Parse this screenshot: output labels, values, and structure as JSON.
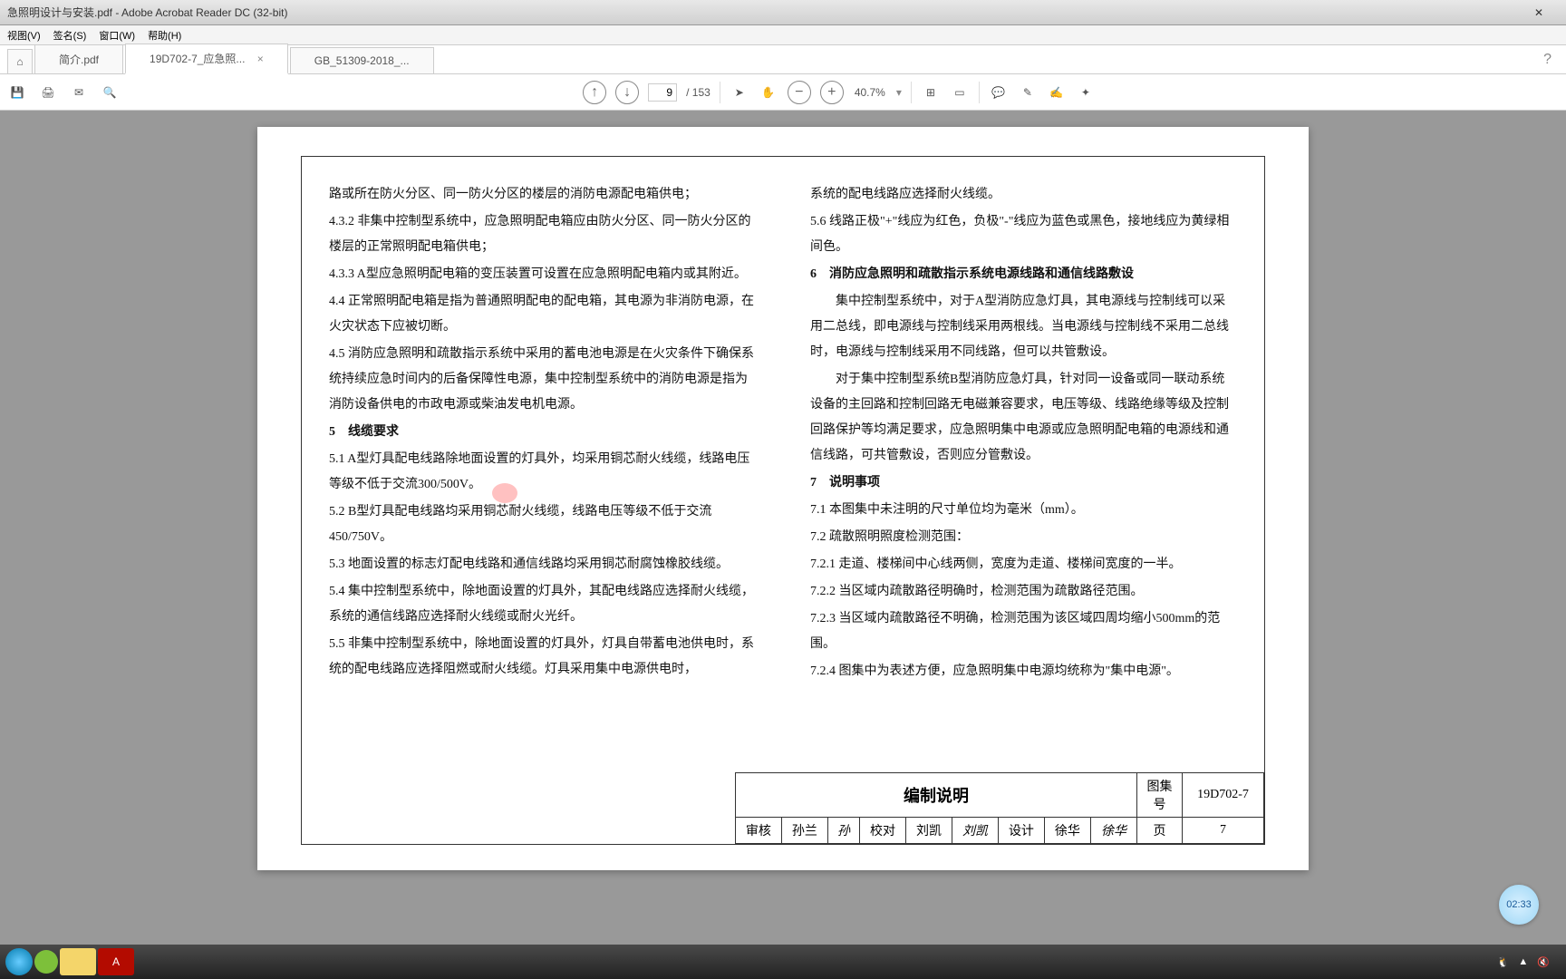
{
  "title": "急照明设计与安装.pdf - Adobe Acrobat Reader DC (32-bit)",
  "menu": {
    "view": "视图(V)",
    "sign": "签名(S)",
    "window": "窗口(W)",
    "help": "帮助(H)"
  },
  "tabs": {
    "t1": "简介.pdf",
    "t2": "19D702-7_应急照...",
    "t3": "GB_51309-2018_..."
  },
  "page": {
    "current": "9",
    "total": "/ 153",
    "zoom": "40.7%"
  },
  "doc": {
    "left": {
      "p1": "路或所在防火分区、同一防火分区的楼层的消防电源配电箱供电；",
      "p2": "4.3.2 非集中控制型系统中，应急照明配电箱应由防火分区、同一防火分区的楼层的正常照明配电箱供电；",
      "p3": "4.3.3  A型应急照明配电箱的变压装置可设置在应急照明配电箱内或其附近。",
      "p4": "4.4  正常照明配电箱是指为普通照明配电的配电箱，其电源为非消防电源，在火灾状态下应被切断。",
      "p5": "4.5  消防应急照明和疏散指示系统中采用的蓄电池电源是在火灾条件下确保系统持续应急时间内的后备保障性电源，集中控制型系统中的消防电源是指为消防设备供电的市政电源或柴油发电机电源。",
      "s5": "5　线缆要求",
      "p6": "5.1  A型灯具配电线路除地面设置的灯具外，均采用铜芯耐火线缆，线路电压等级不低于交流300/500V。",
      "p7": "5.2  B型灯具配电线路均采用铜芯耐火线缆，线路电压等级不低于交流450/750V。",
      "p8": "5.3 地面设置的标志灯配电线路和通信线路均采用铜芯耐腐蚀橡胶线缆。",
      "p9": "5.4  集中控制型系统中，除地面设置的灯具外，其配电线路应选择耐火线缆，系统的通信线路应选择耐火线缆或耐火光纤。",
      "p10": "5.5  非集中控制型系统中，除地面设置的灯具外，灯具自带蓄电池供电时，系统的配电线路应选择阻燃或耐火线缆。灯具采用集中电源供电时，"
    },
    "right": {
      "p1": "系统的配电线路应选择耐火线缆。",
      "p2": "5.6  线路正极\"+\"线应为红色，负极\"-\"线应为蓝色或黑色，接地线应为黄绿相间色。",
      "s6": "6　消防应急照明和疏散指示系统电源线路和通信线路敷设",
      "p3": "　　集中控制型系统中，对于A型消防应急灯具，其电源线与控制线可以采用二总线，即电源线与控制线采用两根线。当电源线与控制线不采用二总线时，电源线与控制线采用不同线路，但可以共管敷设。",
      "p4": "　　对于集中控制型系统B型消防应急灯具，针对同一设备或同一联动系统设备的主回路和控制回路无电磁兼容要求，电压等级、线路绝缘等级及控制回路保护等均满足要求，应急照明集中电源或应急照明配电箱的电源线和通信线路，可共管敷设，否则应分管敷设。",
      "s7": "7　说明事项",
      "p5": "7.1  本图集中未注明的尺寸单位均为毫米（mm）。",
      "p6": "7.2  疏散照明照度检测范围：",
      "p7": "7.2.1  走道、楼梯间中心线两侧，宽度为走道、楼梯间宽度的一半。",
      "p8": "7.2.2  当区域内疏散路径明确时，检测范围为疏散路径范围。",
      "p9": "7.2.3  当区域内疏散路径不明确，检测范围为该区域四周均缩小500mm的范围。",
      "p10": "7.2.4  图集中为表述方便，应急照明集中电源均统称为\"集中电源\"。"
    },
    "stamp": {
      "title": "编制说明",
      "atlas_label": "图集号",
      "atlas": "19D702-7",
      "shenhe": "审核",
      "name1": "孙兰",
      "sig1": "孙",
      "jiaodui": "校对",
      "name2": "刘凯",
      "sig2": "刘凯",
      "sheji": "设计",
      "name3": "徐华",
      "sig3": "徐华",
      "page_label": "页",
      "page_num": "7"
    }
  },
  "clock": "02:33"
}
